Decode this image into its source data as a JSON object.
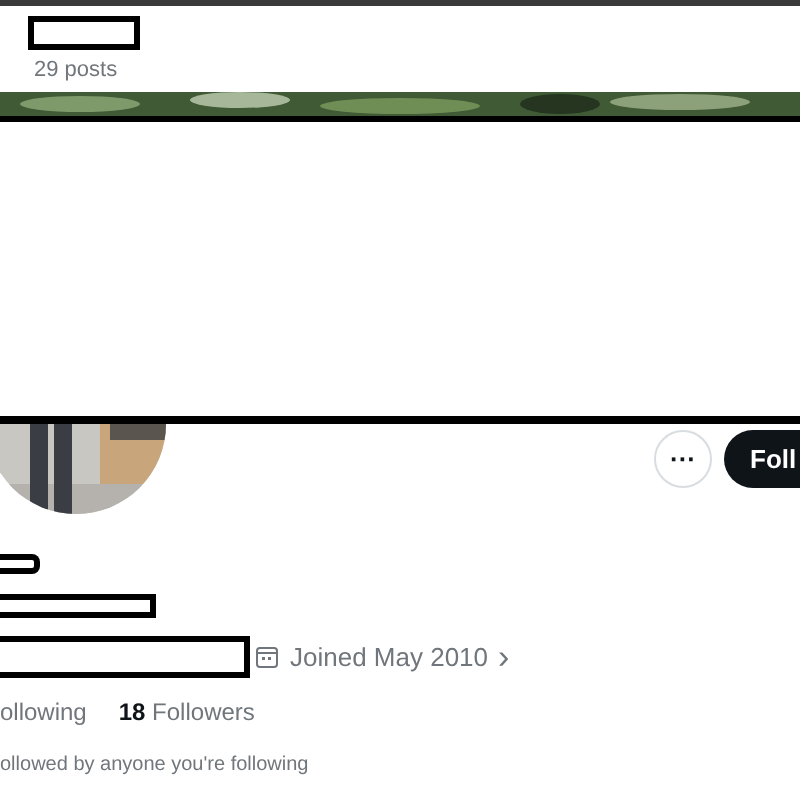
{
  "header": {
    "post_count": "29 posts"
  },
  "profile": {
    "more_button": "···",
    "follow_button": "Foll",
    "joined": "Joined May 2010",
    "joined_chevron": "›",
    "following": "ollowing",
    "followers": "**18** Followers",
    "followed_by": "ollowed by anyone you're following"
  }
}
